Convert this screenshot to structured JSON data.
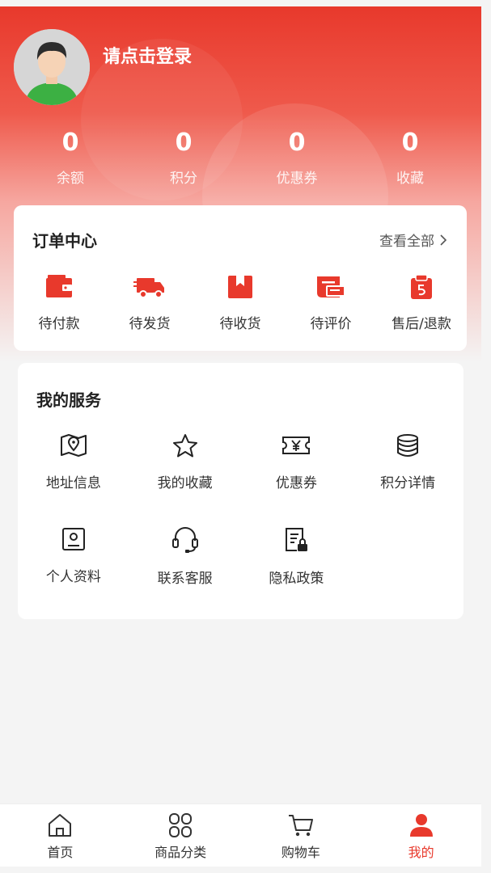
{
  "profile": {
    "login_prompt": "请点击登录"
  },
  "stats": [
    {
      "value": "0",
      "label": "余额"
    },
    {
      "value": "0",
      "label": "积分"
    },
    {
      "value": "0",
      "label": "优惠券"
    },
    {
      "value": "0",
      "label": "收藏"
    }
  ],
  "orders": {
    "title": "订单中心",
    "view_all": "查看全部",
    "items": [
      {
        "label": "待付款",
        "icon": "wallet-icon"
      },
      {
        "label": "待发货",
        "icon": "truck-icon"
      },
      {
        "label": "待收货",
        "icon": "package-icon"
      },
      {
        "label": "待评价",
        "icon": "review-icon"
      },
      {
        "label": "售后/退款",
        "icon": "refund-icon"
      }
    ]
  },
  "services": {
    "title": "我的服务",
    "items": [
      {
        "label": "地址信息",
        "icon": "map-icon"
      },
      {
        "label": "我的收藏",
        "icon": "star-icon"
      },
      {
        "label": "优惠券",
        "icon": "coupon-icon"
      },
      {
        "label": "积分详情",
        "icon": "coins-icon"
      },
      {
        "label": "个人资料",
        "icon": "profile-card-icon"
      },
      {
        "label": "联系客服",
        "icon": "headset-icon"
      },
      {
        "label": "隐私政策",
        "icon": "privacy-doc-icon"
      }
    ]
  },
  "tabbar": {
    "items": [
      {
        "label": "首页",
        "icon": "home-icon"
      },
      {
        "label": "商品分类",
        "icon": "category-icon"
      },
      {
        "label": "购物车",
        "icon": "cart-icon"
      },
      {
        "label": "我的",
        "icon": "user-icon"
      }
    ],
    "active": "我的"
  },
  "colors": {
    "accent": "#e8392c",
    "background": "#f4f4f4"
  }
}
